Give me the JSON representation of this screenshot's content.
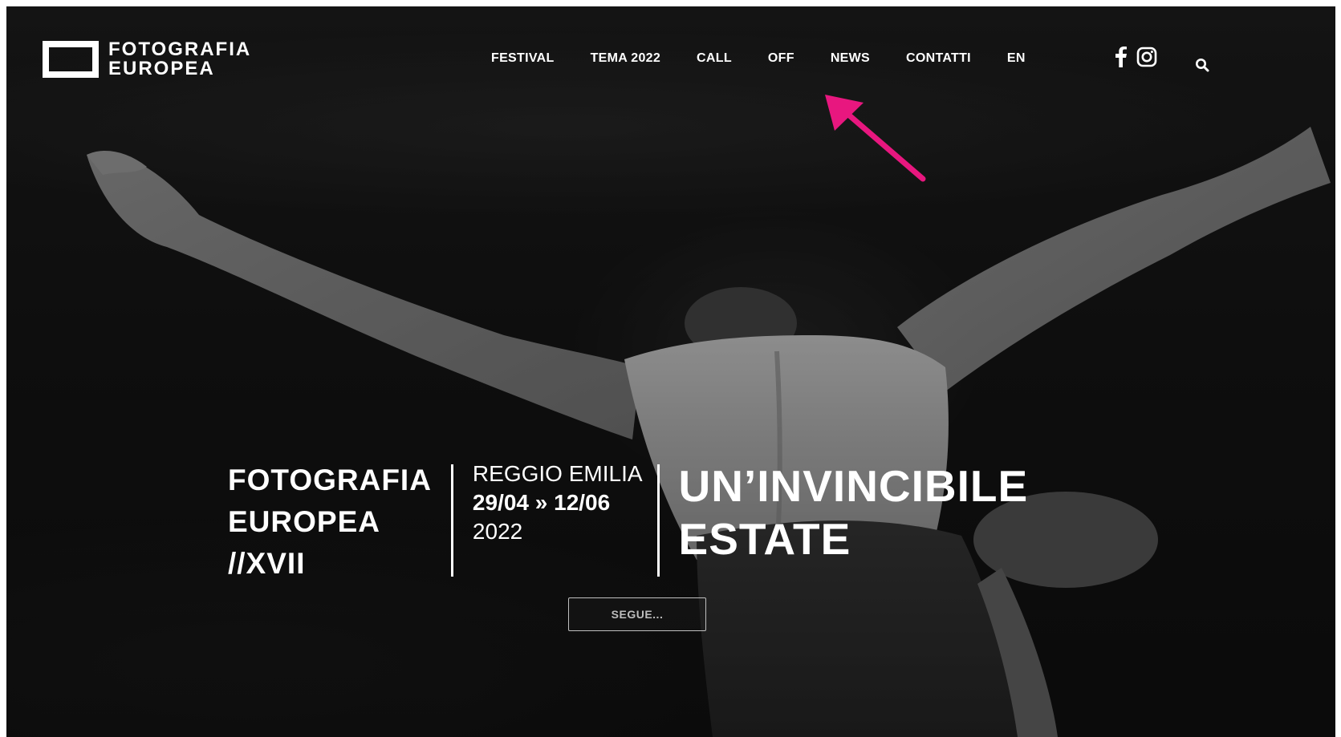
{
  "logo": {
    "line1": "FOTOGRAFIA",
    "line2": "EUROPEA"
  },
  "nav": {
    "items": [
      {
        "label": "FESTIVAL"
      },
      {
        "label": "TEMA 2022"
      },
      {
        "label": "CALL"
      },
      {
        "label": "OFF"
      },
      {
        "label": "NEWS"
      },
      {
        "label": "CONTATTI"
      },
      {
        "label": "EN"
      }
    ],
    "social": [
      "facebook-icon",
      "instagram-icon"
    ],
    "search_icon": "search-icon"
  },
  "annotation": {
    "color": "#e8177f",
    "target": "OFF"
  },
  "hero": {
    "festival_line1": "FOTOGRAFIA",
    "festival_line2": "EUROPEA",
    "festival_line3": "//XVII",
    "city": "REGGIO EMILIA",
    "dates": "29/04 » 12/06",
    "year": "2022",
    "theme_line1": "UN’INVINCIBILE",
    "theme_line2": "ESTATE",
    "cta_label": "SEGUE..."
  }
}
